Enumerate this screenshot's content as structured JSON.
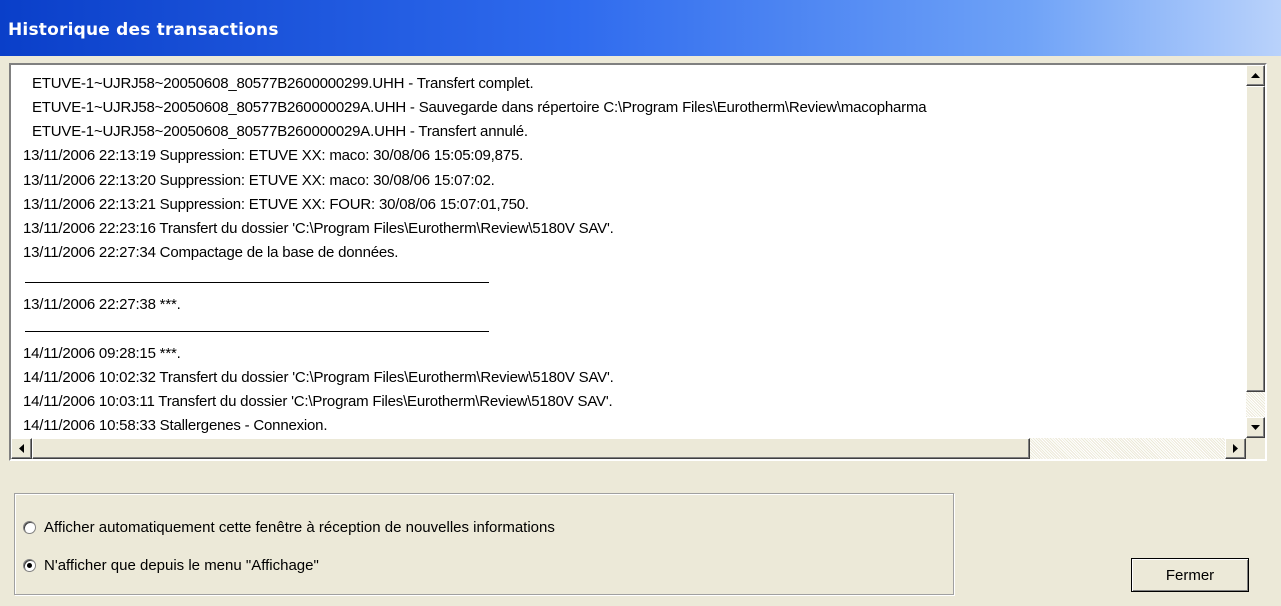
{
  "window": {
    "title": "Historique des transactions"
  },
  "log": {
    "lines": [
      "ETUVE-1~UJRJ58~20050608_80577B2600000299.UHH - Transfert complet.",
      "ETUVE-1~UJRJ58~20050608_80577B260000029A.UHH - Sauvegarde dans répertoire C:\\Program Files\\Eurotherm\\Review\\macopharma",
      "ETUVE-1~UJRJ58~20050608_80577B260000029A.UHH - Transfert annulé.",
      "13/11/2006 22:13:19  Suppression: ETUVE XX: maco: 30/08/06 15:05:09,875.",
      "13/11/2006 22:13:20  Suppression: ETUVE XX: maco: 30/08/06 15:07:02.",
      "13/11/2006 22:13:21  Suppression: ETUVE XX: FOUR: 30/08/06 15:07:01,750.",
      "13/11/2006 22:23:16  Transfert du dossier 'C:\\Program Files\\Eurotherm\\Review\\5180V SAV'.",
      "13/11/2006 22:27:34  Compactage de la base de données.",
      "13/11/2006 22:27:38  ***.",
      "14/11/2006 09:28:15  ***.",
      "14/11/2006 10:02:32  Transfert du dossier 'C:\\Program Files\\Eurotherm\\Review\\5180V SAV'.",
      "14/11/2006 10:03:11  Transfert du dossier 'C:\\Program Files\\Eurotherm\\Review\\5180V SAV'.",
      "14/11/2006 10:58:33  Stallergenes - Connexion."
    ]
  },
  "options": {
    "auto_label": "Afficher automatiquement cette fenêtre à réception de nouvelles informations",
    "menu_label": "N'afficher que depuis le menu \"Affichage\"",
    "selected": "menu"
  },
  "buttons": {
    "close_label": "Fermer"
  },
  "icons": {
    "scroll_up": "arrow-up-icon",
    "scroll_down": "arrow-down-icon",
    "scroll_left": "arrow-left-icon",
    "scroll_right": "arrow-right-icon"
  },
  "colors": {
    "titlebar_start": "#0a3fc9",
    "titlebar_end": "#b9d2fb",
    "dialog_bg": "#ece9d8"
  }
}
